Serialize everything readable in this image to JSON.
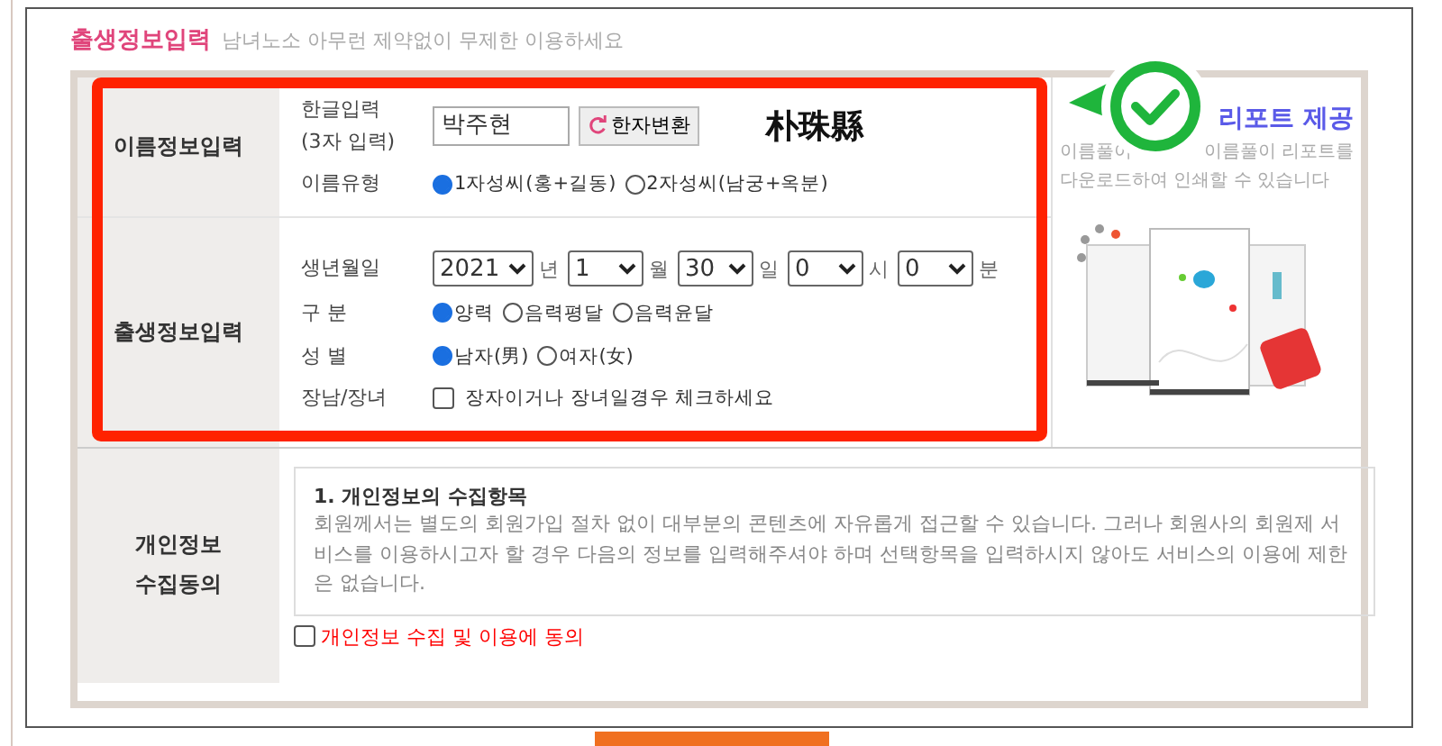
{
  "heading": {
    "title": "출생정보입력",
    "subtitle": "남녀노소 아무런 제약없이 무제한 이용하세요"
  },
  "name_section": {
    "header": "이름정보입력",
    "input_label": "한글입력\n(3자 입력)",
    "name_value": "박주현",
    "convert_button": "한자변환",
    "hanja": "朴珠縣",
    "type_label": "이름유형",
    "type_options": [
      {
        "label": "1자성씨(홍+길동)",
        "selected": true
      },
      {
        "label": "2자성씨(남궁+옥분)",
        "selected": false
      }
    ]
  },
  "birth_section": {
    "header": "출생정보입력",
    "date_label": "생년월일",
    "date_fields": [
      {
        "value": "2021",
        "unit": "년"
      },
      {
        "value": "1",
        "unit": "월"
      },
      {
        "value": "30",
        "unit": "일"
      },
      {
        "value": "0",
        "unit": "시"
      },
      {
        "value": "0",
        "unit": "분"
      }
    ],
    "calendar_label": "구 분",
    "calendar_options": [
      {
        "label": "양력",
        "selected": true
      },
      {
        "label": "음력평달",
        "selected": false
      },
      {
        "label": "음력윤달",
        "selected": false
      }
    ],
    "gender_label": "성 별",
    "gender_options": [
      {
        "label": "남자(男)",
        "selected": true
      },
      {
        "label": "여자(女)",
        "selected": false
      }
    ],
    "eldest_label": "장남/장녀",
    "eldest_checkbox": {
      "label": "장자이거나 장녀일경우 체크하세요",
      "checked": false
    }
  },
  "promo": {
    "title": "리포트 제공",
    "description_parts": [
      "이름풀이",
      "이름풀이 리포트를"
    ],
    "description_line2": "다운로드하여 인쇄할 수 있습니다"
  },
  "privacy_section": {
    "header": "개인정보\n수집동의",
    "notice_title": "1. 개인정보의 수집항목",
    "notice_text": "회원께서는 별도의 회원가입 절차 없이 대부분의 콘텐츠에 자유롭게 접근할 수 있습니다. 그러나 회원사의 회원제 서비스를 이용하시고자 할 경우 다음의 정보를 입력해주셔야 하며 선택항목을 입력하시지 않아도 서비스의 이용에 제한은 없습니다.",
    "agree_checkbox": {
      "label": "개인정보 수집 및 이용에 동의",
      "checked": false
    }
  }
}
